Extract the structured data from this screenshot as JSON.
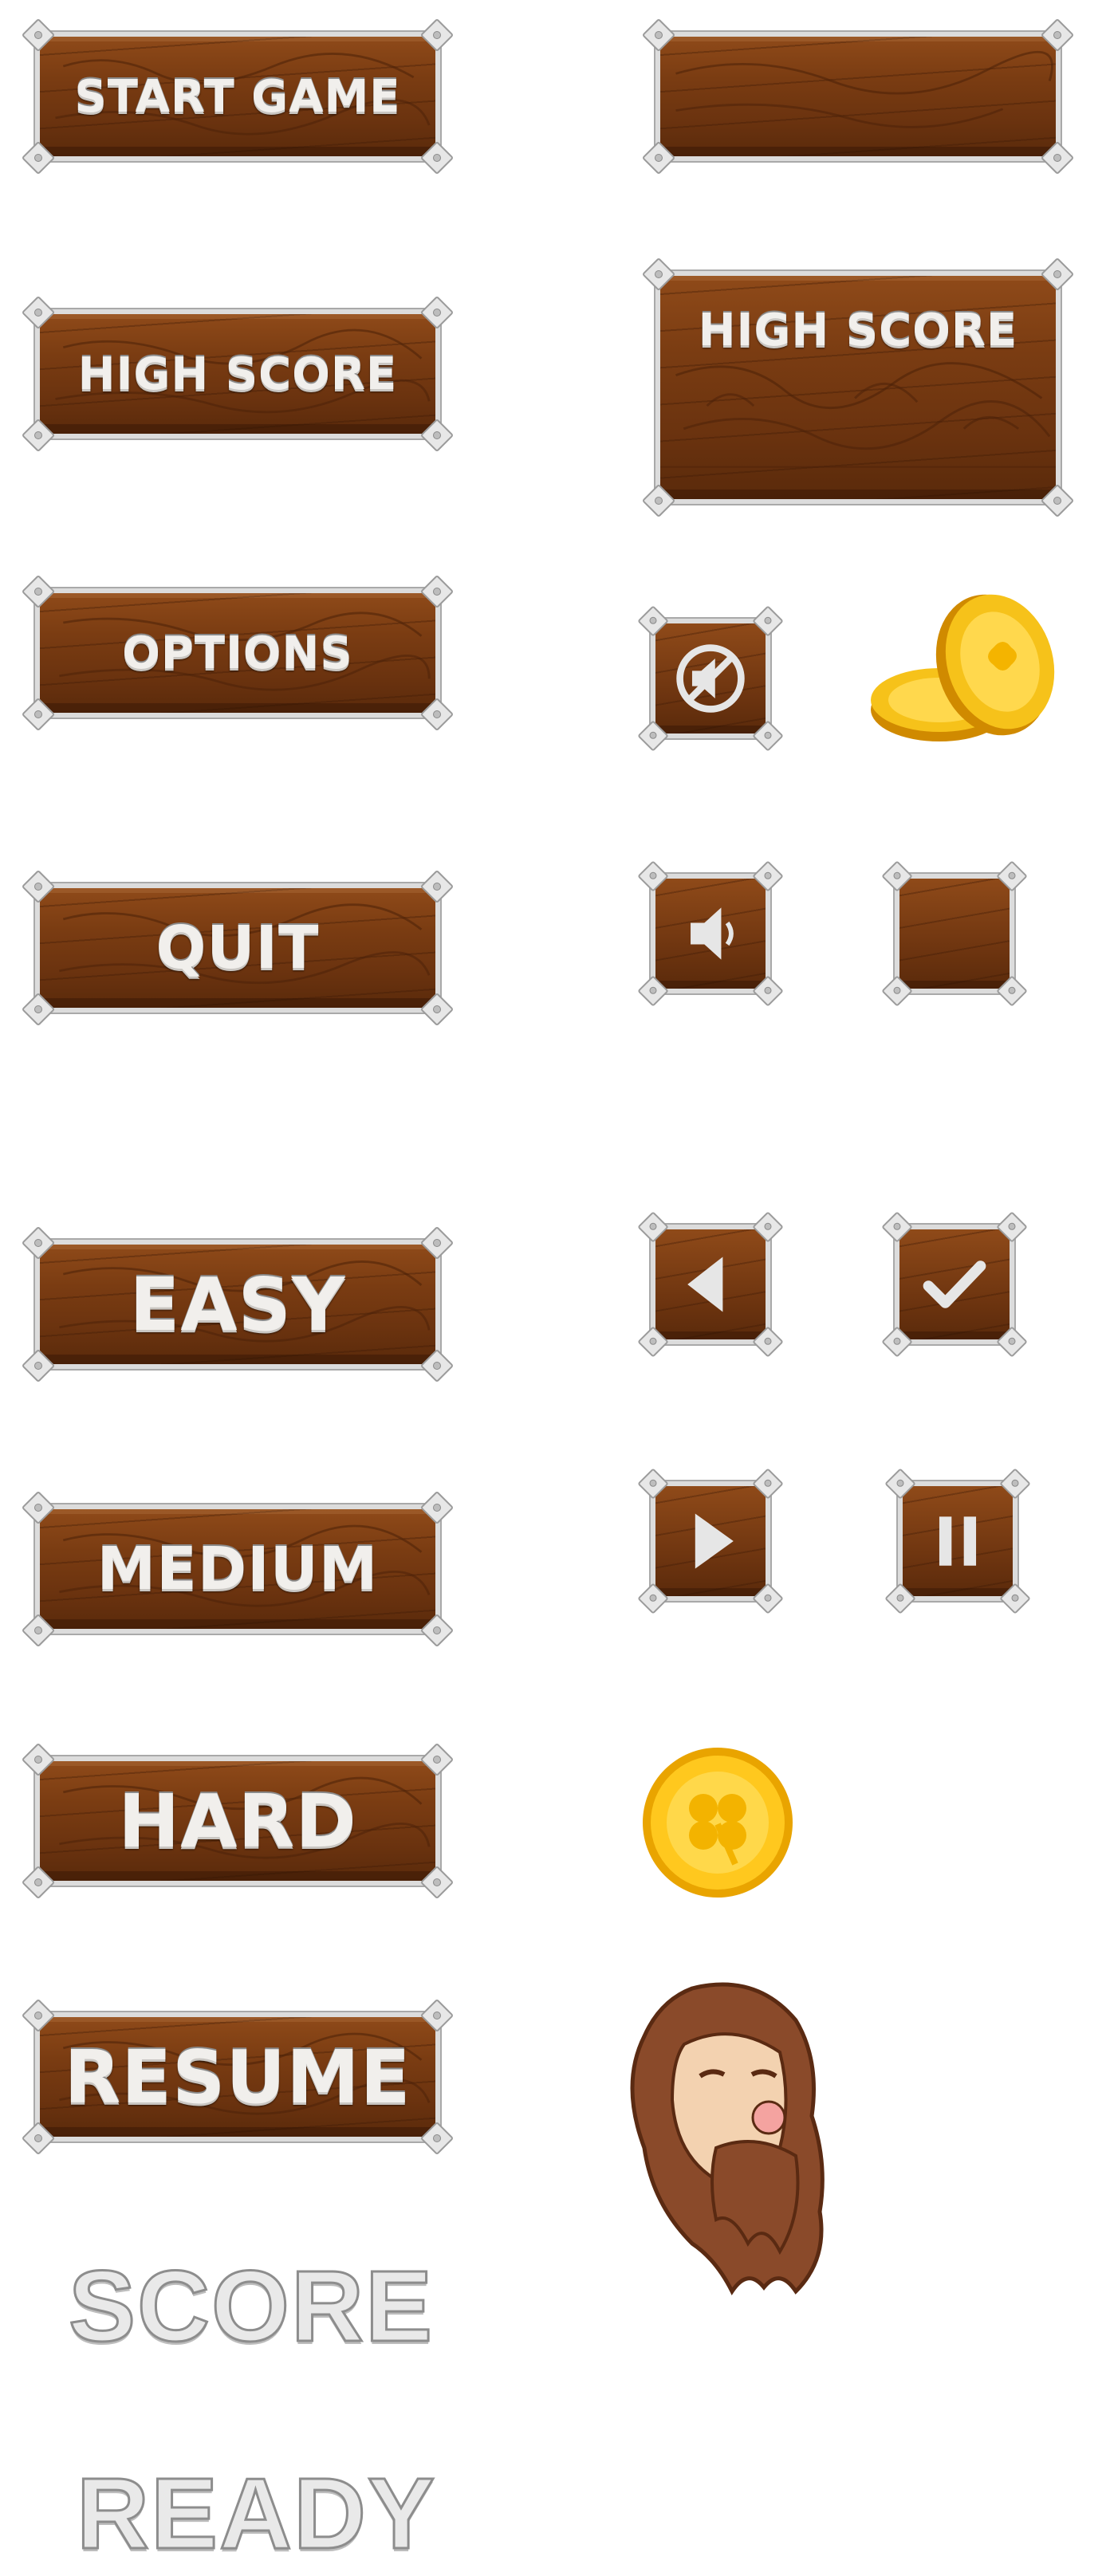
{
  "menu": {
    "start_game": "START GAME",
    "high_score": "HIGH SCORE",
    "options": "OPTIONS",
    "quit": "QUIT"
  },
  "large_panel": {
    "title": "HIGH SCORE"
  },
  "difficulty": {
    "easy": "EASY",
    "medium": "MEDIUM",
    "hard": "HARD",
    "resume": "RESUME"
  },
  "labels": {
    "score": "SCORE",
    "ready": "READY"
  },
  "icons": {
    "mute": "mute-icon",
    "sound": "sound-icon",
    "blank": "blank-square-button",
    "back": "back-arrow-icon",
    "check": "checkmark-icon",
    "play": "play-icon",
    "pause": "pause-icon",
    "coin": "coin-icon",
    "coin_stack": "coin-stack-icon",
    "character": "bearded-dwarf-head"
  },
  "colors": {
    "wood": "#7a3c12",
    "metal": "#dcdcdc",
    "gold": "#f4b400"
  }
}
